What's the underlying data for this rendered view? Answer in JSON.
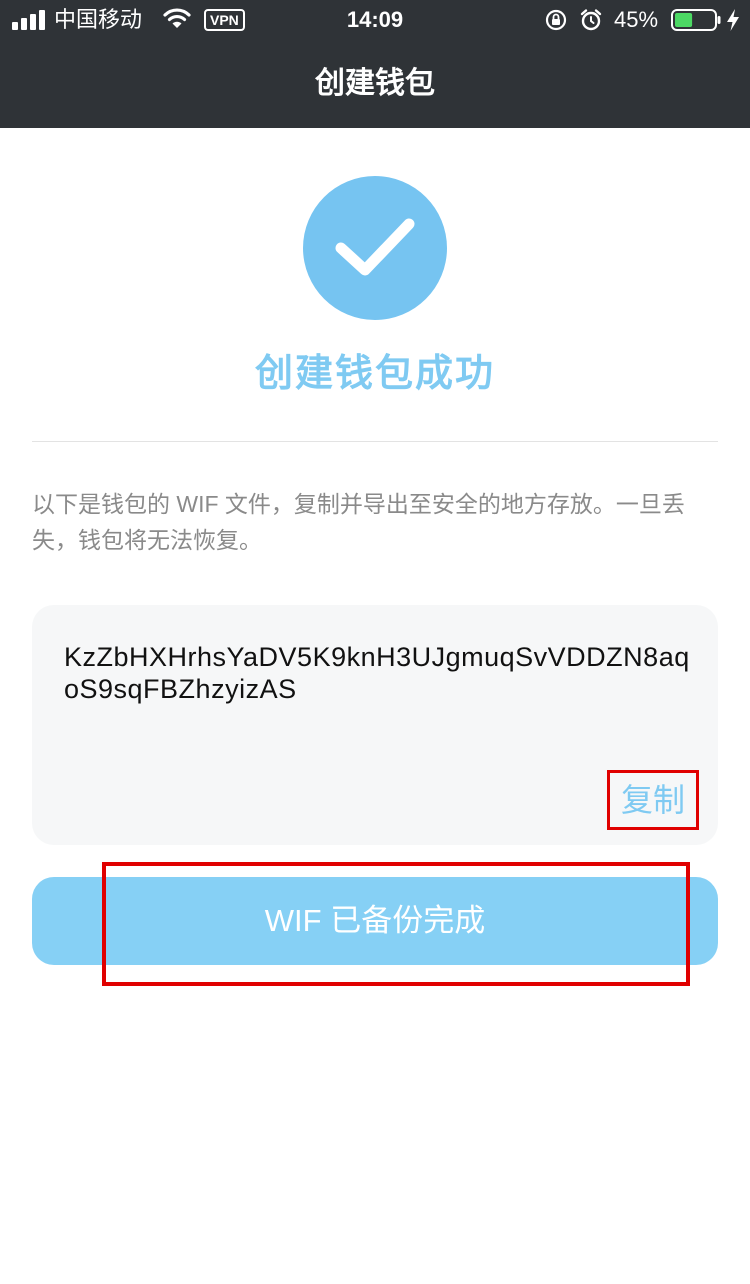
{
  "status_bar": {
    "carrier": "中国移动",
    "vpn": "VPN",
    "time": "14:09",
    "battery": "45%",
    "battery_level": 0.45
  },
  "nav": {
    "title": "创建钱包"
  },
  "success": {
    "icon": "checkmark-icon",
    "title": "创建钱包成功"
  },
  "description": "以下是钱包的 WIF 文件，复制并导出至安全的地方存放。一旦丢失，钱包将无法恢复。",
  "wif": {
    "value": "KzZbHXHrhsYaDV5K9knH3UJgmuqSvVDDZN8aqoS9sqFBZhzyizAS",
    "copy_label": "复制"
  },
  "backup_button": {
    "label": "WIF 已备份完成"
  },
  "colors": {
    "header_bg": "#2f3337",
    "accent": "#76c4f1",
    "button_bg": "#86d0f5",
    "highlight": "#e00000"
  }
}
